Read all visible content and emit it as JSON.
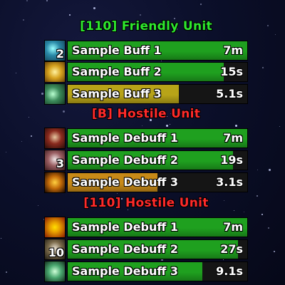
{
  "colors": {
    "friendly_title": "#2ee82e",
    "hostile_title": "#ff2a2a",
    "bar_green": "#1fa01f",
    "bar_yellow": "#b8a418",
    "bar_orange": "#c88a18",
    "track_bg": "#151515"
  },
  "groups": [
    {
      "title": "[110] Friendly Unit",
      "title_color": "friendly",
      "bars": [
        {
          "label": "Sample Buff 1",
          "time": "7m",
          "stack": "2",
          "fill_fraction": 1.0,
          "fill_color": "green",
          "icon": "buff-swirl-icon"
        },
        {
          "label": "Sample Buff 2",
          "time": "15s",
          "stack": "",
          "fill_fraction": 0.87,
          "fill_color": "green",
          "icon": "buff-gold-icon"
        },
        {
          "label": "Sample Buff 3",
          "time": "5.1s",
          "stack": "",
          "fill_fraction": 0.62,
          "fill_color": "yellow",
          "icon": "buff-nature-icon"
        }
      ]
    },
    {
      "title": "[B] Hostile Unit",
      "title_color": "hostile",
      "bars": [
        {
          "label": "Sample Debuff 1",
          "time": "7m",
          "stack": "",
          "fill_fraction": 1.0,
          "fill_color": "green",
          "icon": "debuff-warrior-icon"
        },
        {
          "label": "Sample Debuff 2",
          "time": "19s",
          "stack": "3",
          "fill_fraction": 0.92,
          "fill_color": "green",
          "icon": "debuff-bone-icon"
        },
        {
          "label": "Sample Debuff 3",
          "time": "3.1s",
          "stack": "",
          "fill_fraction": 0.5,
          "fill_color": "orange",
          "icon": "debuff-claw-icon"
        }
      ]
    },
    {
      "title": "[110] Hostile Unit",
      "title_color": "hostile",
      "bars": [
        {
          "label": "Sample Debuff 1",
          "time": "7m",
          "stack": "",
          "fill_fraction": 1.0,
          "fill_color": "green",
          "icon": "debuff-radiation-icon"
        },
        {
          "label": "Sample Debuff 2",
          "time": "27s",
          "stack": "10",
          "fill_fraction": 0.95,
          "fill_color": "green",
          "icon": "debuff-skull-icon"
        },
        {
          "label": "Sample Debuff 3",
          "time": "9.1s",
          "stack": "",
          "fill_fraction": 0.75,
          "fill_color": "green",
          "icon": "debuff-orb-icon"
        }
      ]
    }
  ]
}
